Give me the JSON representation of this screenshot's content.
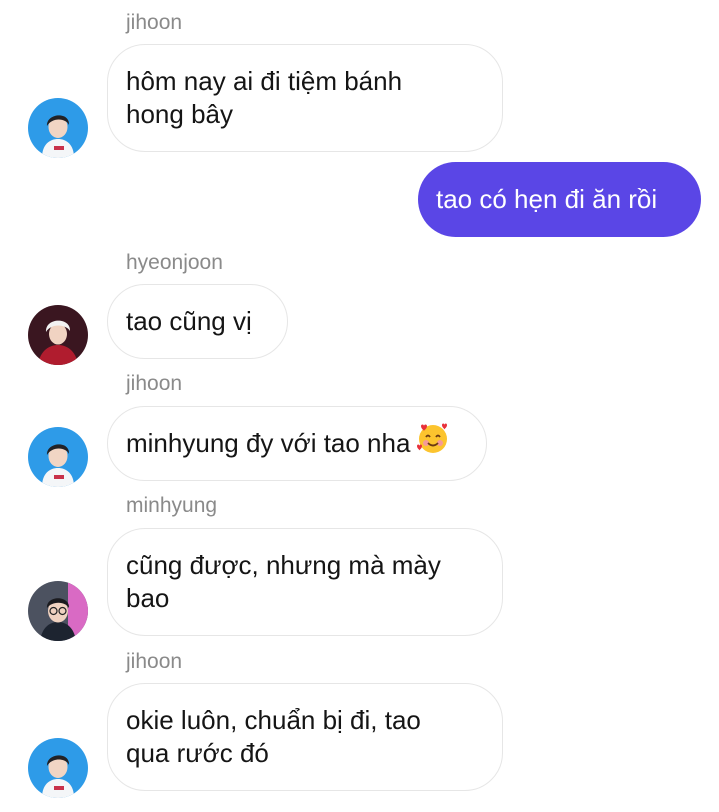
{
  "conversation": {
    "messages": [
      {
        "direction": "incoming",
        "sender": "jihoon",
        "avatar": "jihoon-avatar",
        "text": "hôm nay ai đi tiệm bánh\nhong bây"
      },
      {
        "direction": "outgoing",
        "text": "tao có hẹn đi ăn rồi"
      },
      {
        "direction": "incoming",
        "sender": "hyeonjoon",
        "avatar": "hyeonjoon-avatar",
        "text": "tao cũng vị"
      },
      {
        "direction": "incoming",
        "sender": "jihoon",
        "avatar": "jihoon-avatar",
        "text": "minhyung đy với tao nha",
        "emoji": "smiling-face-with-hearts"
      },
      {
        "direction": "incoming",
        "sender": "minhyung",
        "avatar": "minhyung-avatar",
        "text": "cũng được, nhưng mà mày\nbao"
      },
      {
        "direction": "incoming",
        "sender": "jihoon",
        "avatar": "jihoon-avatar",
        "text": "okie luôn, chuẩn bị đi, tao\nqua rước đó"
      }
    ]
  },
  "colors": {
    "outgoing_bubble": "#5a46e6",
    "incoming_bubble": "#ffffff",
    "incoming_border": "#e6e6e6",
    "sender_name": "#8a8a8a",
    "message_text": "#151515"
  }
}
